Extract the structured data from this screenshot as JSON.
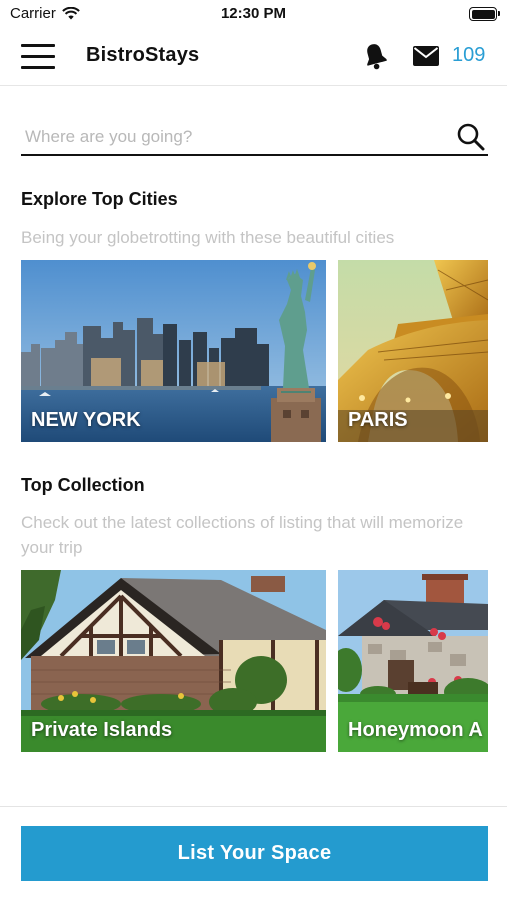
{
  "status_bar": {
    "carrier": "Carrier",
    "time": "12:30 PM",
    "icons": [
      "wifi-icon",
      "battery-icon"
    ]
  },
  "nav": {
    "title": "BistroStays",
    "notification_count": "109",
    "icons": [
      "hamburger-menu-icon",
      "bell-icon",
      "mail-icon"
    ]
  },
  "search": {
    "placeholder": "Where are you going?",
    "value": ""
  },
  "explore": {
    "title": "Explore Top Cities",
    "subtitle": "Being your globetrotting with these beautiful cities",
    "cities": [
      {
        "label": "NEW YORK"
      },
      {
        "label": "PARIS"
      }
    ]
  },
  "collection": {
    "title": "Top Collection",
    "subtitle": "Check out the latest collections of listing that will memorize your trip",
    "items": [
      {
        "label": "Private Islands"
      },
      {
        "label": "Honeymoon A"
      }
    ]
  },
  "cta": {
    "label": "List Your Space"
  },
  "colors": {
    "accent": "#249bcf",
    "count_text": "#2a9ed4",
    "subtitle_text": "#c4c4c4"
  }
}
